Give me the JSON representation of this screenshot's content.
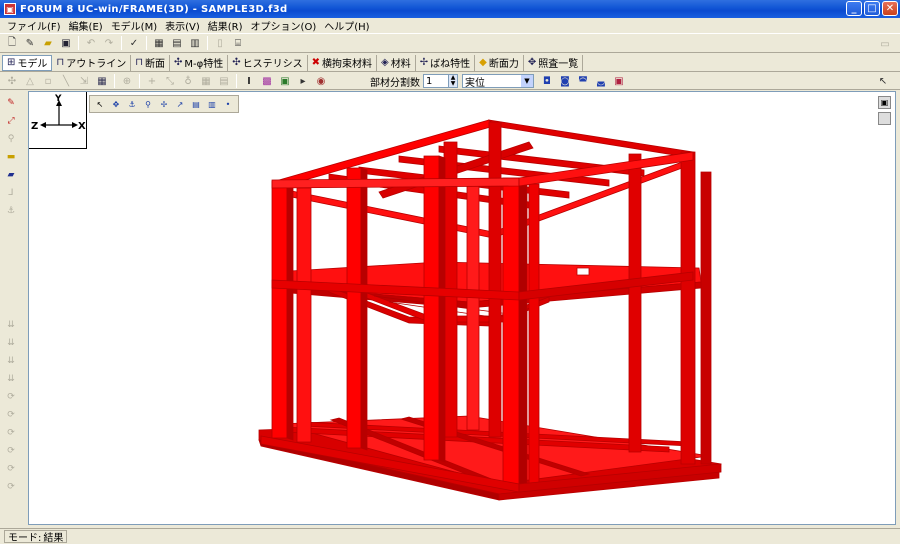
{
  "window": {
    "title": "FORUM 8  UC-win/FRAME(3D) - SAMPLE3D.f3d",
    "min": "_",
    "max": "□",
    "close": "✕"
  },
  "menu": [
    "ファイル(F)",
    "編集(E)",
    "モデル(M)",
    "表示(V)",
    "結果(R)",
    "オプション(O)",
    "ヘルプ(H)"
  ],
  "tabs": [
    {
      "label": "モデル",
      "icon": "⊞",
      "active": true
    },
    {
      "label": "アウトライン",
      "icon": "⊓"
    },
    {
      "label": "断面",
      "icon": "⊓"
    },
    {
      "label": "M-φ特性",
      "icon": "✣"
    },
    {
      "label": "ヒステリシス",
      "icon": "✣"
    },
    {
      "label": "横拘束材料",
      "icon": "✖"
    },
    {
      "label": "材料",
      "icon": "◈"
    },
    {
      "label": "ばね特性",
      "icon": "✢"
    },
    {
      "label": "断面力",
      "icon": "◆"
    },
    {
      "label": "照査一覧",
      "icon": "✥"
    }
  ],
  "toolbar2": {
    "division_label": "部材分割数",
    "division_value": "1",
    "unit_value": "実位"
  },
  "axes": {
    "y": "Y",
    "z": "Z",
    "x": "X"
  },
  "status": {
    "mode_label": "モード:",
    "mode_value": "結果"
  },
  "colors": {
    "frame": "#ee0000",
    "frame_dark": "#b50000",
    "frame_light": "#ff3030"
  }
}
